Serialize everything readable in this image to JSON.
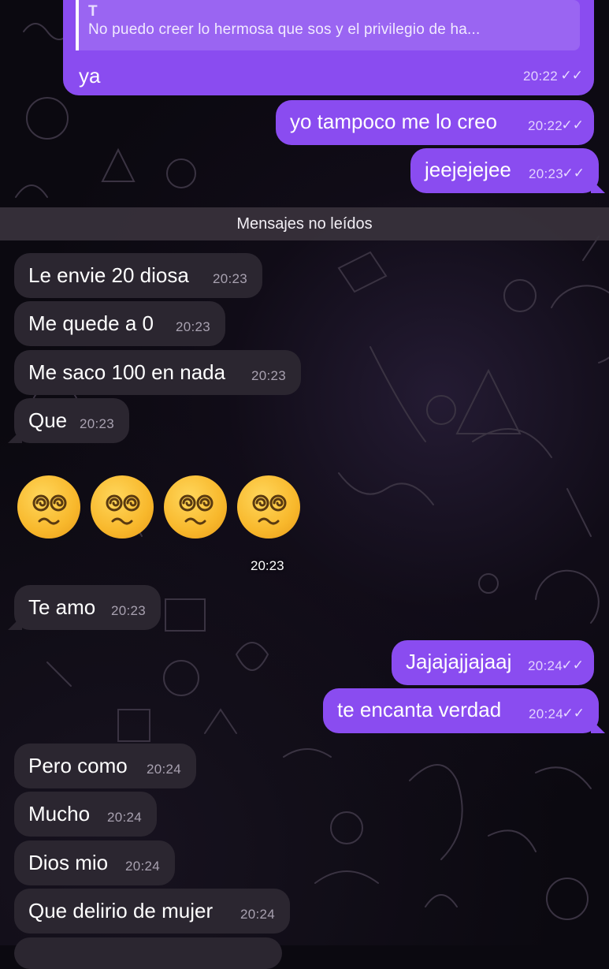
{
  "reply": {
    "quoted_name": "T",
    "quoted_text": "No puedo creer lo hermosa que sos y el privilegio de ha...",
    "text": "ya",
    "time": "20:22"
  },
  "messages_top": [
    {
      "text": "yo tampoco me lo creo",
      "time": "20:22",
      "direction": "out"
    },
    {
      "text": "jeejejejee",
      "time": "20:23",
      "direction": "out"
    }
  ],
  "unread_divider": "Mensajes no leídos",
  "messages_mid": [
    {
      "text": "Le envie 20 diosa",
      "time": "20:23",
      "direction": "in"
    },
    {
      "text": "Me quede a 0",
      "time": "20:23",
      "direction": "in"
    },
    {
      "text": "Me saco 100 en nada",
      "time": "20:23",
      "direction": "in"
    },
    {
      "text": "Que",
      "time": "20:23",
      "direction": "in"
    }
  ],
  "emoji_message": {
    "emoji_name": "face-with-spiral-eyes",
    "count": 4,
    "time": "20:23"
  },
  "messages_bottom": [
    {
      "text": "Te amo",
      "time": "20:23",
      "direction": "in"
    },
    {
      "text": "Jajajajjajaaj",
      "time": "20:24",
      "direction": "out"
    },
    {
      "text": "te encanta verdad",
      "time": "20:24",
      "direction": "out"
    },
    {
      "text": "Pero como",
      "time": "20:24",
      "direction": "in"
    },
    {
      "text": "Mucho",
      "time": "20:24",
      "direction": "in"
    },
    {
      "text": "Dios mio",
      "time": "20:24",
      "direction": "in"
    },
    {
      "text": "Que delirio de mujer",
      "time": "20:24",
      "direction": "in"
    }
  ],
  "read_ticks": "✓✓",
  "colors": {
    "outgoing_bubble": "#8a4cf0",
    "incoming_bubble": "#2b2630",
    "background": "#0b0910"
  }
}
